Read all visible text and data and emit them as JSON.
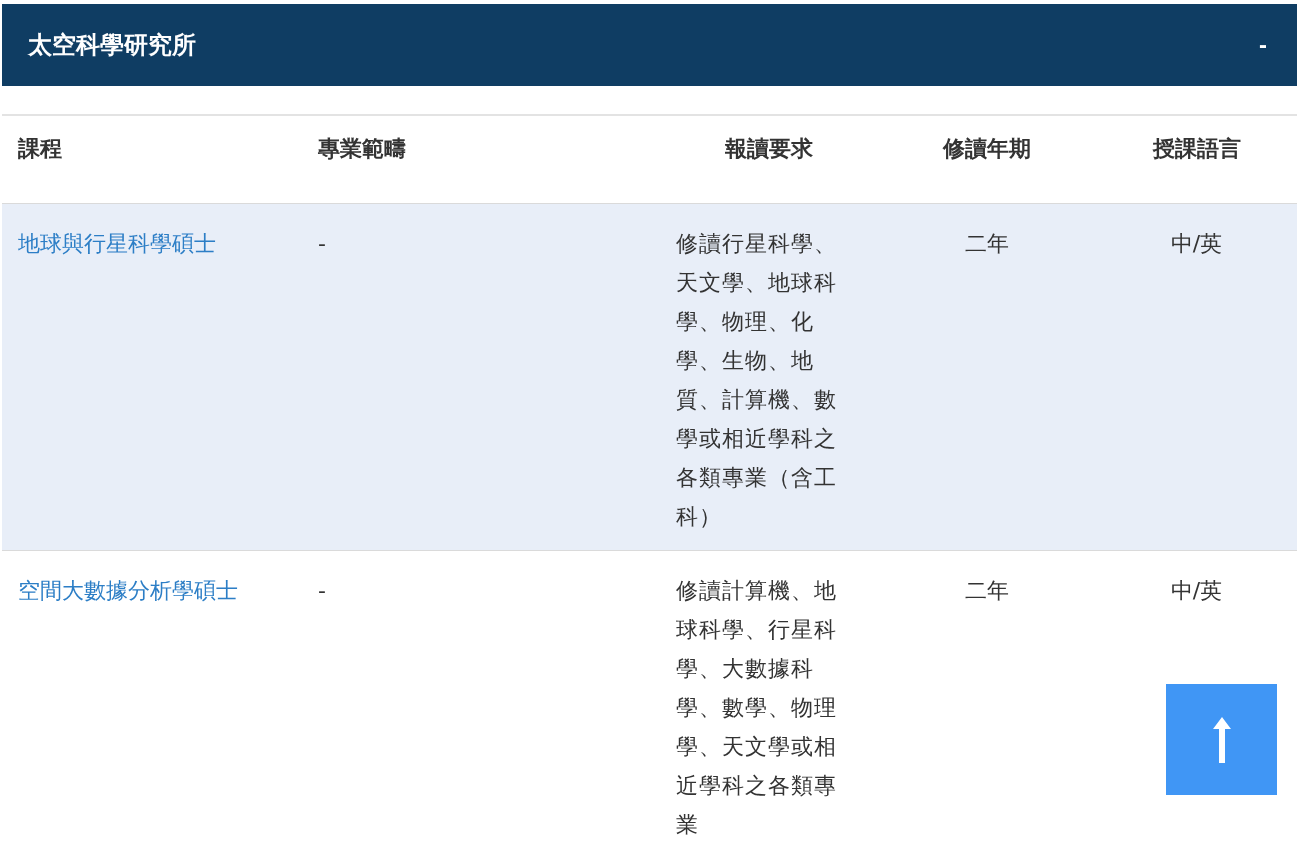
{
  "section": {
    "title": "太空科學研究所",
    "toggle": "-"
  },
  "table": {
    "columns": [
      "課程",
      "專業範疇",
      "報讀要求",
      "修讀年期",
      "授課語言"
    ],
    "rows": [
      {
        "course": "地球與行星科學碩士",
        "specialization": "-",
        "requirements": "修讀行星科學、天文學、地球科學、物理、化學、生物、地質、計算機、數學或相近學科之各類專業（含工科）",
        "duration": "二年",
        "language": "中/英",
        "highlighted": true
      },
      {
        "course": "空間大數據分析學碩士",
        "specialization": "-",
        "requirements": "修讀計算機、地球科學、行星科學、大數據科學、數學、物理學、天文學或相近學科之各類專業",
        "duration": "二年",
        "language": "中/英",
        "highlighted": false
      }
    ]
  }
}
